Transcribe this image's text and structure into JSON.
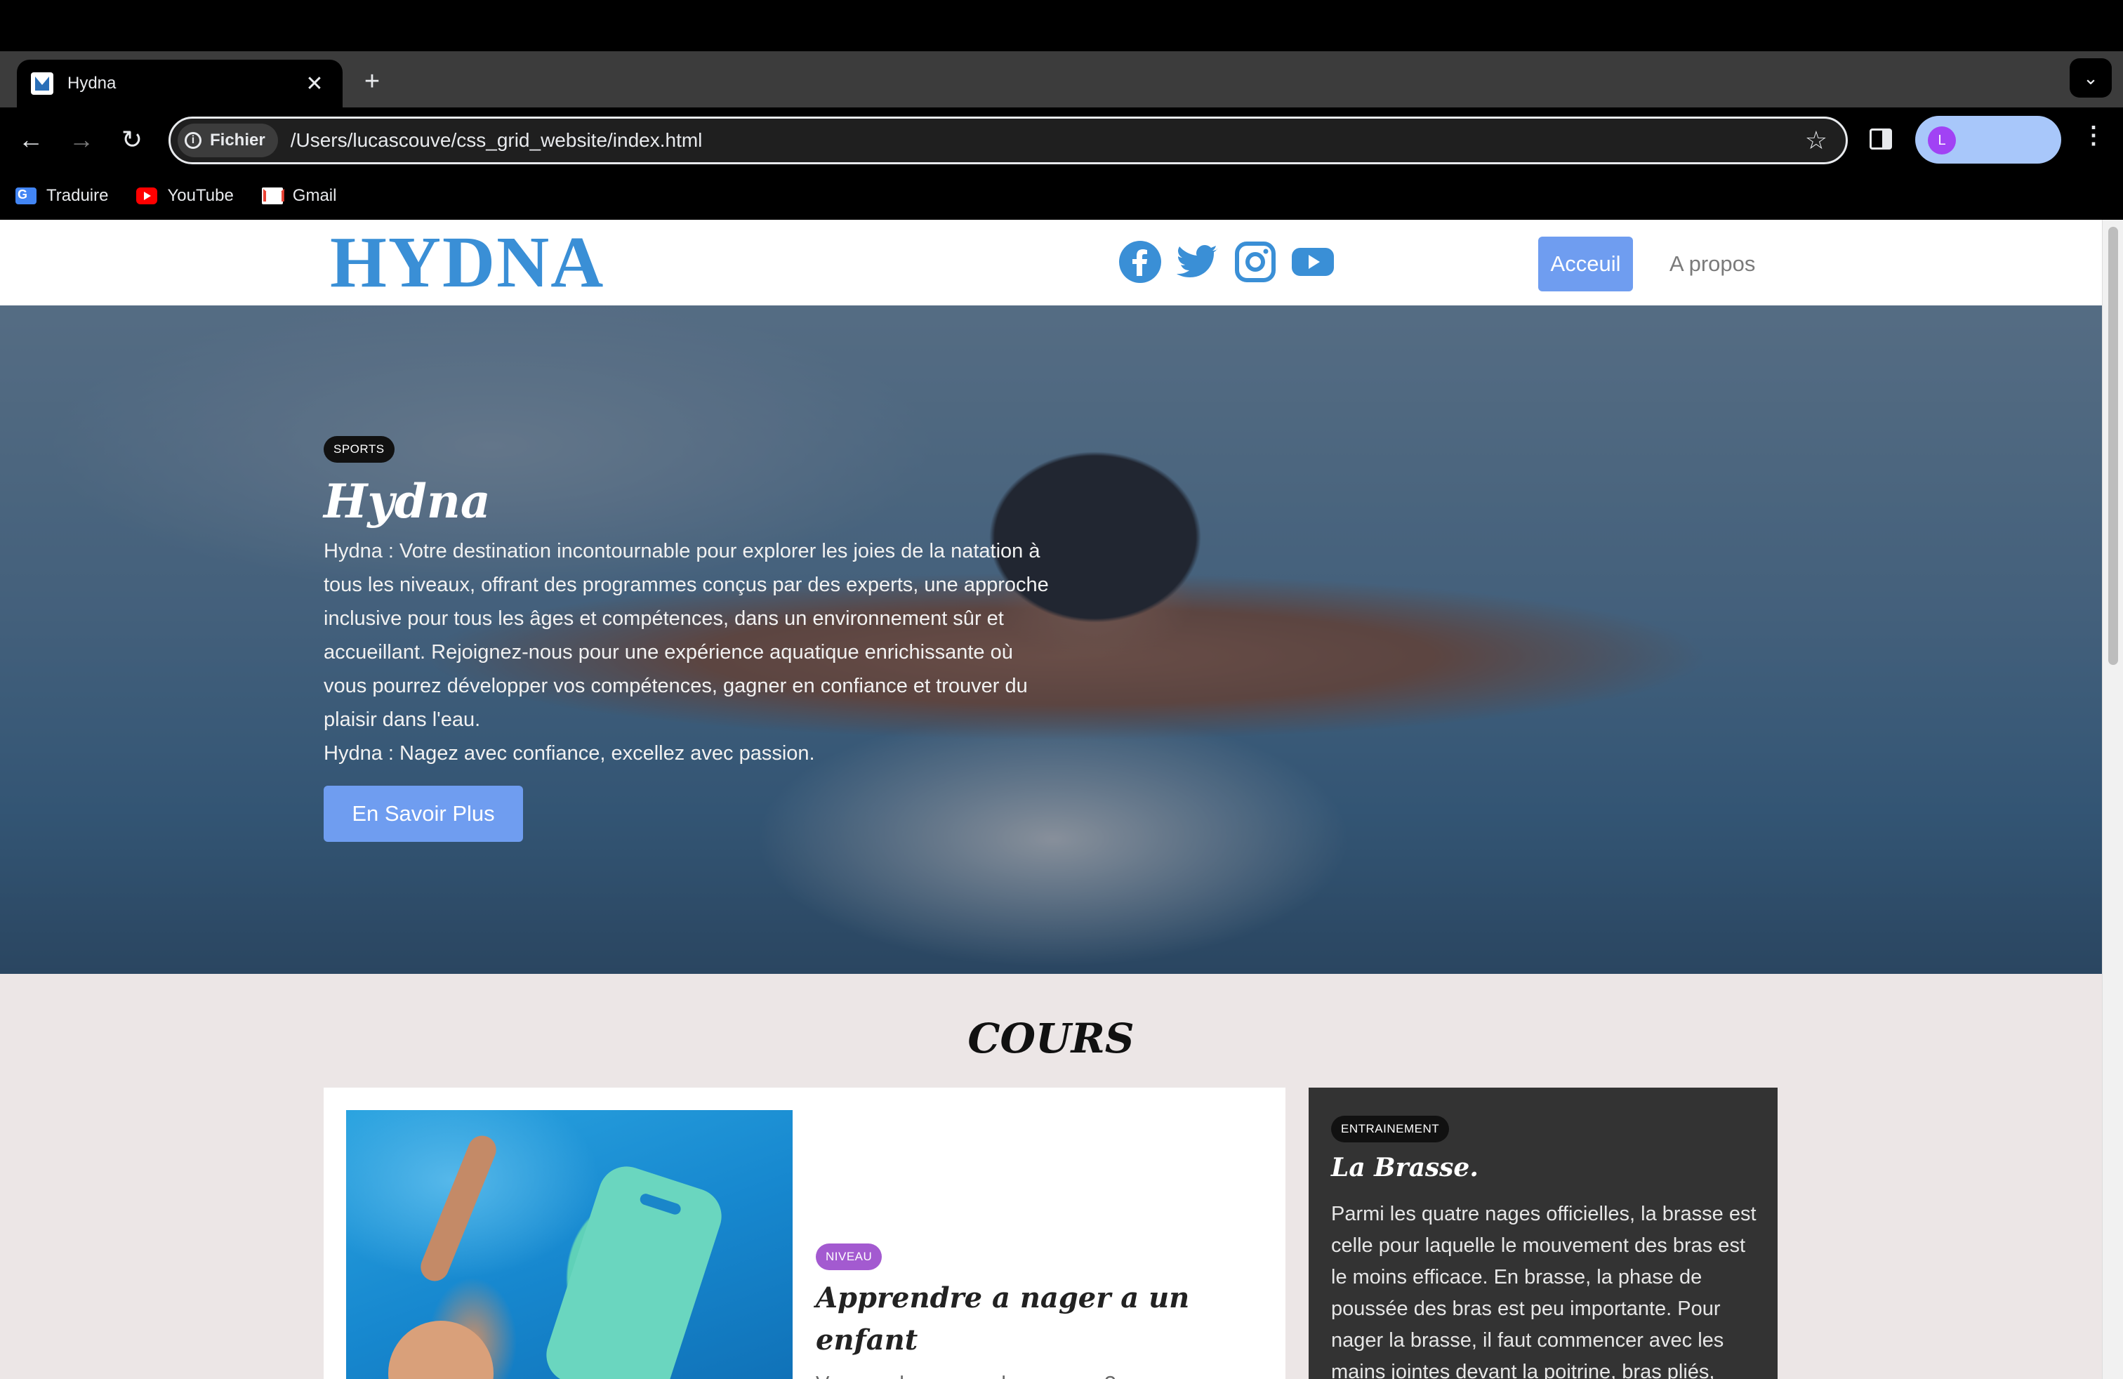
{
  "browser": {
    "tab_title": "Hydna",
    "tab_close": "✕",
    "new_tab": "+",
    "tab_menu": "⌄",
    "chip_label": "Fichier",
    "url": "/Users/lucascouve/css_grid_website/index.html",
    "avatar_letter": "L",
    "bookmarks": [
      {
        "label": "Traduire",
        "icon": "translate-icon"
      },
      {
        "label": "YouTube",
        "icon": "youtube-icon"
      },
      {
        "label": "Gmail",
        "icon": "gmail-icon"
      }
    ]
  },
  "site": {
    "logo": "HYDNA",
    "nav": {
      "home": "Acceuil",
      "about": "A propos"
    },
    "socials": [
      "facebook-icon",
      "twitter-icon",
      "instagram-icon",
      "youtube-icon"
    ],
    "hero": {
      "tag": "SPORTS",
      "title": "Hydna",
      "text": "Hydna : Votre destination incontournable pour explorer les joies de la natation à tous les niveaux, offrant des programmes conçus par des experts, une approche inclusive pour tous les âges et compétences, dans un environnement sûr et accueillant. Rejoignez-nous pour une expérience aquatique enrichissante où vous pourrez développer vos compétences, gagner en confiance et trouver du plaisir dans l'eau.",
      "slogan": "Hydna : Nagez avec confiance, excellez avec passion.",
      "button": "En Savoir Plus"
    },
    "section_title": "COURS",
    "card1": {
      "tag": "NIVEAU",
      "title": "Apprendre a nager a un enfant",
      "text": "Vous voulez apprendre a nager ? nous vous apprenons les bases de la natation avec cette"
    },
    "card2": {
      "tag": "ENTRAINEMENT",
      "title": "La Brasse.",
      "text": "Parmi les quatre nages officielles, la brasse est celle pour laquelle le mouvement des bras est le moins efficace. En brasse, la phase de poussée des bras est peu importante. Pour nager la brasse, il faut commencer avec les mains jointes devant la poitrine, bras pliés, vous dépliez"
    }
  },
  "colors": {
    "brand_blue": "#3a8fd6",
    "button_blue": "#6f9df0",
    "tag_purple": "#a35ad0",
    "dark_card": "#333333",
    "page_bg": "#ece6e6"
  }
}
